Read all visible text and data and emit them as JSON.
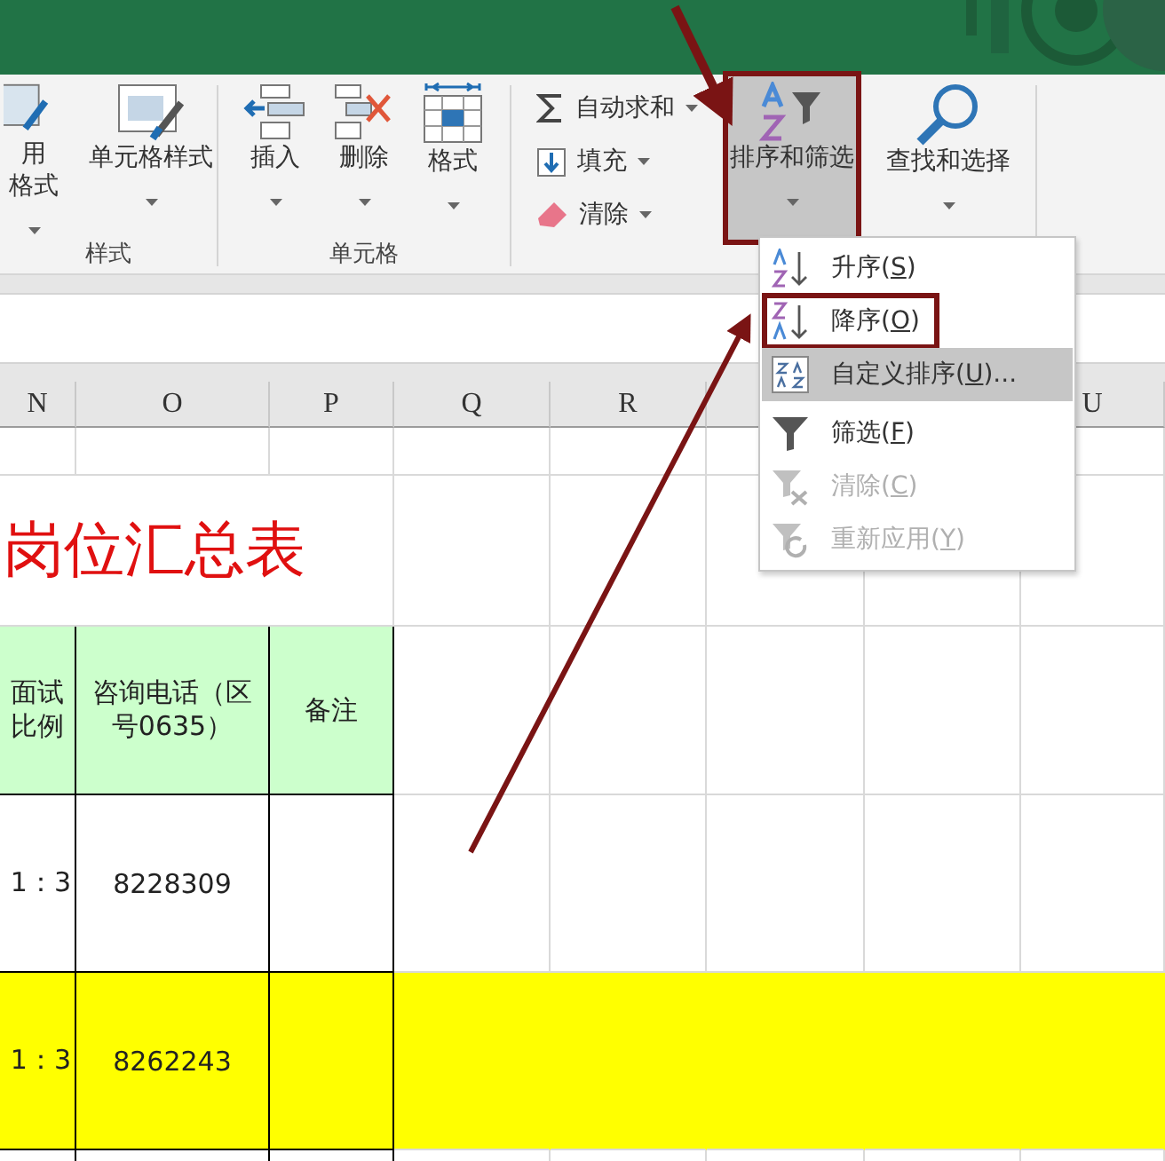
{
  "ribbon": {
    "groups": [
      {
        "label": "样式",
        "items": [
          {
            "kind": "large",
            "lines": [
              "用",
              "格式"
            ],
            "dropdown": true
          },
          {
            "kind": "large",
            "lines": [
              "单元格样式"
            ],
            "dropdown": true
          }
        ]
      },
      {
        "label": "单元格",
        "items": [
          {
            "kind": "large",
            "lines": [
              "插入"
            ],
            "dropdown": true
          },
          {
            "kind": "large",
            "lines": [
              "删除"
            ],
            "dropdown": true
          },
          {
            "kind": "large",
            "lines": [
              "格式"
            ],
            "dropdown": true
          }
        ]
      },
      {
        "items": [
          {
            "kind": "stack",
            "children": [
              {
                "label": "自动求和",
                "dropdown": true
              },
              {
                "label": "填充",
                "dropdown": true
              },
              {
                "label": "清除",
                "dropdown": true
              }
            ]
          },
          {
            "kind": "large",
            "lines": [
              "排序和筛选"
            ],
            "dropdown": true,
            "selected": true,
            "framed": true
          },
          {
            "kind": "large",
            "lines": [
              "查找和选择"
            ],
            "dropdown": true,
            "selected": false
          }
        ]
      }
    ]
  },
  "menu": {
    "items": [
      {
        "before": "升序(",
        "key": "S",
        "after": ")",
        "selected": false,
        "disabled": false,
        "framed": false
      },
      {
        "before": "降序(",
        "key": "O",
        "after": ")",
        "selected": false,
        "disabled": false,
        "framed": true
      },
      {
        "before": "自定义排序(",
        "key": "U",
        "after": ")...",
        "selected": true,
        "disabled": false,
        "framed": false
      },
      {
        "before": "筛选(",
        "key": "F",
        "after": ")",
        "selected": false,
        "disabled": false,
        "framed": false
      },
      {
        "before": "清除(",
        "key": "C",
        "after": ")",
        "selected": false,
        "disabled": true,
        "framed": false
      },
      {
        "before": "重新应用(",
        "key": "Y",
        "after": ")",
        "selected": false,
        "disabled": true,
        "framed": false
      }
    ]
  },
  "sheet": {
    "columns": [
      "N",
      "O",
      "P",
      "Q",
      "R",
      null,
      null,
      "U"
    ],
    "title": "岗位汇总表",
    "header": [
      "面试比例",
      "咨询电话（区号0635）",
      "备注"
    ],
    "rows": [
      {
        "cells": [
          "1：3",
          "8228309"
        ],
        "highlighted": false
      },
      {
        "cells": [
          "1：3",
          "8262243"
        ],
        "highlighted": true
      }
    ]
  }
}
